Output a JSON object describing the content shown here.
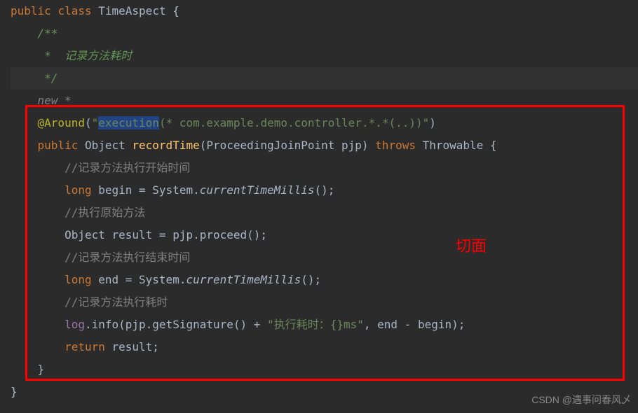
{
  "code": {
    "line1": {
      "kw_public": "public",
      "kw_class": "class",
      "class_name": "TimeAspect",
      "brace": " {"
    },
    "line2": {
      "indent": "    ",
      "comment": "/**"
    },
    "line3": {
      "indent": "     ",
      "star": "* ",
      "text": " 记录方法耗时"
    },
    "line4": {
      "indent": "     ",
      "comment": "*/"
    },
    "line5": {
      "indent": "    ",
      "kw_new": "new *"
    },
    "line6": {
      "indent": "    ",
      "annotation": "@Around",
      "paren": "(",
      "str1": "\"",
      "str_exec": "execution",
      "str2": "(* com.example.demo.controller.*.*(..))\"",
      "paren2": ")"
    },
    "line7": {
      "indent": "    ",
      "kw_public": "public",
      "ret_type": " Object ",
      "method": "recordTime",
      "params": "(ProceedingJoinPoint pjp) ",
      "kw_throws": "throws",
      "exc": " Throwable {"
    },
    "line8": {
      "indent": "        ",
      "comment": "//记录方法执行开始时间"
    },
    "line9": {
      "indent": "        ",
      "kw_long": "long",
      "var_assign": " begin = System.",
      "method": "currentTimeMillis",
      "tail": "();"
    },
    "line10": {
      "indent": "        ",
      "comment": "//执行原始方法"
    },
    "line11": {
      "indent": "        ",
      "text": "Object result = pjp.proceed();"
    },
    "line12": {
      "indent": "        ",
      "comment": "//记录方法执行结束时间"
    },
    "line13": {
      "indent": "        ",
      "kw_long": "long",
      "var_assign": " end = System.",
      "method": "currentTimeMillis",
      "tail": "();"
    },
    "line14": {
      "indent": "        ",
      "comment": "//记录方法执行耗时"
    },
    "line15": {
      "indent": "        ",
      "log_var": "log",
      "text1": ".info(pjp.getSignature() + ",
      "str": "\"执行耗时：{}ms\"",
      "text2": ", end - begin);"
    },
    "line16": {
      "indent": "        ",
      "kw_return": "return",
      "text": " result;"
    },
    "line17": {
      "indent": "    ",
      "brace": "}"
    },
    "line18": {
      "brace": "}"
    }
  },
  "annotation_label": "切面",
  "watermark": "CSDN @遇事问春风乄"
}
